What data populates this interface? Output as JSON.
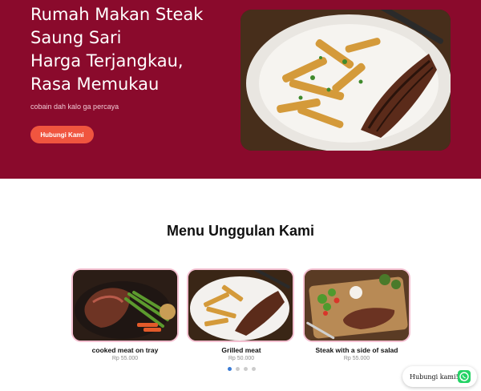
{
  "hero": {
    "title_lines": [
      "Rumah Makan Steak",
      "Saung Sari",
      "Harga Terjangkau,",
      "Rasa Memukau"
    ],
    "subtitle": "cobain dah kalo ga percaya",
    "cta_label": "Hubungi Kami"
  },
  "menu": {
    "heading": "Menu Unggulan Kami",
    "items": [
      {
        "name": "cooked meat on tray",
        "price": "Rp 55.000"
      },
      {
        "name": "Grilled meat",
        "price": "Rp 50.000"
      },
      {
        "name": "Steak with a side of salad",
        "price": "Rp 55.000"
      }
    ],
    "carousel": {
      "pages": 4,
      "active_index": 0
    }
  },
  "whatsapp": {
    "label": "Hubungi kami!",
    "icon": "whatsapp-icon"
  },
  "colors": {
    "hero_bg": "#8a0a2c",
    "cta": "#f0553f",
    "card_border": "#f3bfd0",
    "whatsapp": "#25d366",
    "dot_active": "#3a7bd5"
  }
}
